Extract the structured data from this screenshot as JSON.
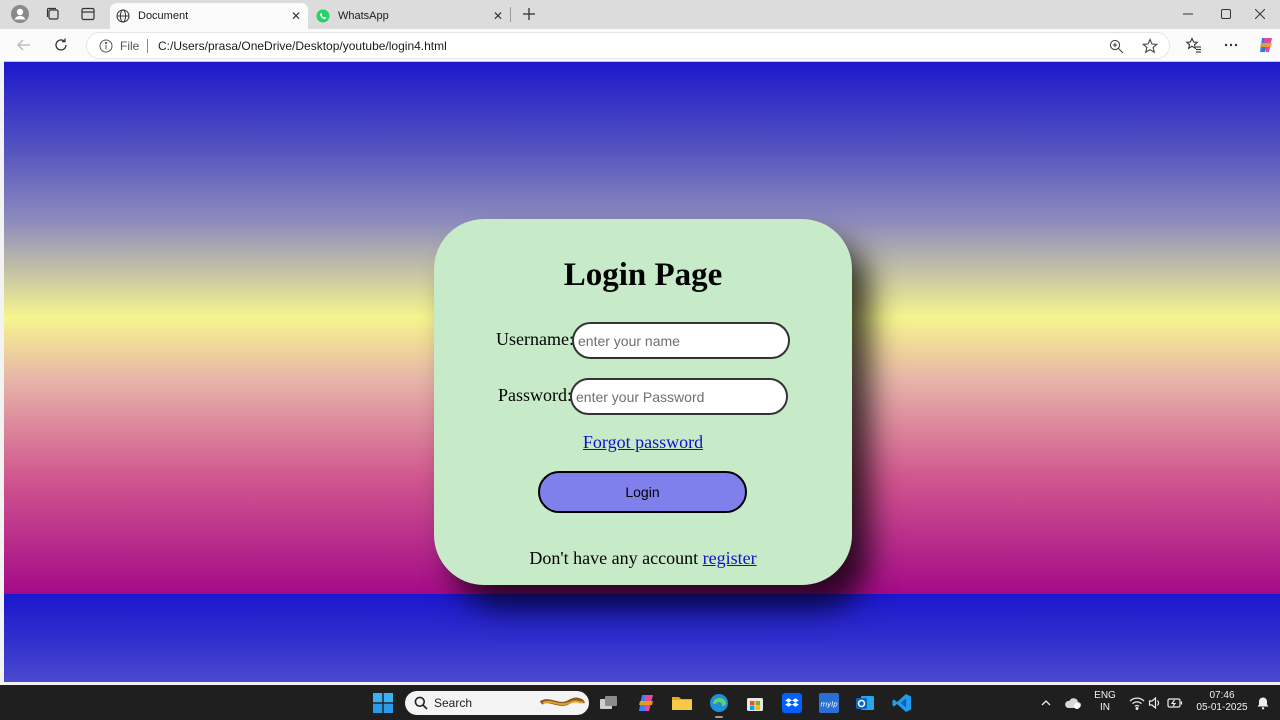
{
  "browser": {
    "tabs": [
      {
        "title": "Document",
        "active": true
      },
      {
        "title": "WhatsApp",
        "active": false
      }
    ],
    "close_glyph": "✕",
    "address": {
      "scheme_label": "File",
      "url": "C:/Users/prasa/OneDrive/Desktop/youtube/login4.html"
    }
  },
  "page": {
    "heading": "Login Page",
    "username": {
      "label": "Username:",
      "placeholder": "enter your name"
    },
    "password": {
      "label": "Password:",
      "placeholder": "enter your Password"
    },
    "forgot_link": "Forgot password",
    "login_button": "Login",
    "register_prompt": "Don't have any account",
    "register_link": "register",
    "colors": {
      "card": "#c7eac8",
      "button": "#7f80ec",
      "link": "#1010c8"
    }
  },
  "taskbar": {
    "search_label": "Search",
    "language": "ENG",
    "region": "IN",
    "time": "07:46",
    "date": "05-01-2025"
  }
}
